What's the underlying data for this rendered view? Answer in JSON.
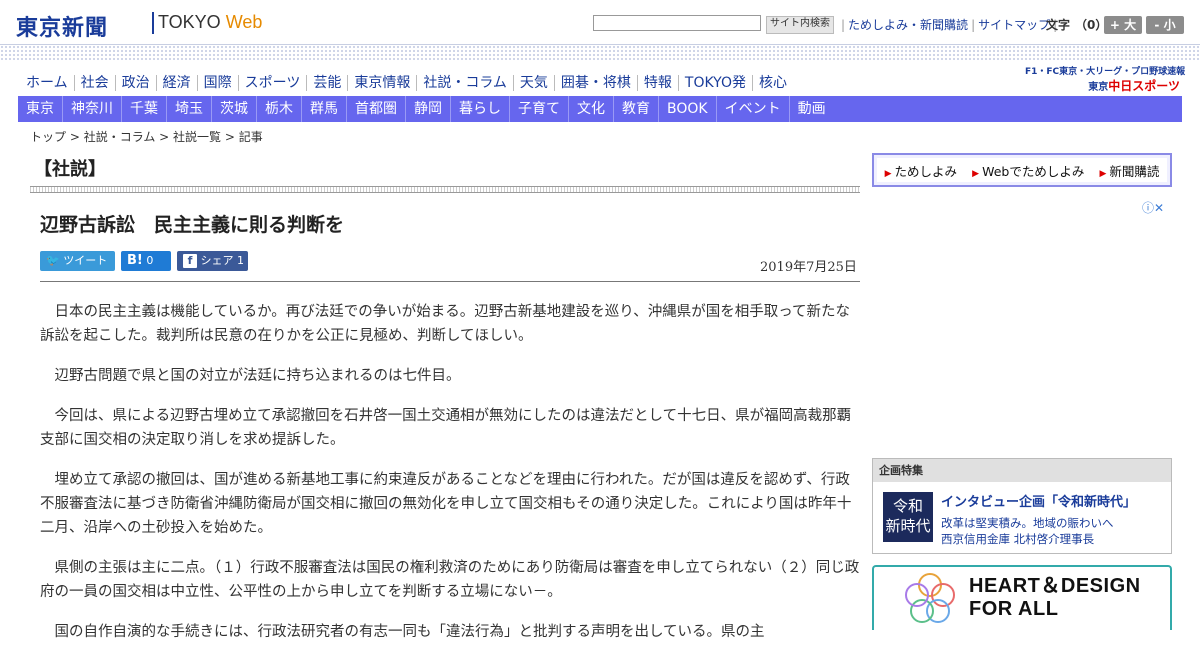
{
  "header": {
    "logo_ja": "東京新聞",
    "logo_en_1": "TOKYO",
    "logo_en_2": "Web",
    "search_placeholder": "",
    "search_button": "サイト内検索",
    "top_links": [
      "ためしよみ・新聞購読",
      "サイトマップ"
    ],
    "font_label": "文字",
    "font_value": "（0）",
    "font_plus": "+ 大",
    "font_minus": "- 小"
  },
  "main_nav": [
    "ホーム",
    "社会",
    "政治",
    "経済",
    "国際",
    "スポーツ",
    "芸能",
    "東京情報",
    "社説・コラム",
    "天気",
    "囲碁・将棋",
    "特報",
    "TOKYO発",
    "核心"
  ],
  "chunichi": {
    "line1": "F1・FC東京・大リーグ・プロ野球速報",
    "prefix": "東京",
    "name": "中日スポーツ"
  },
  "sub_nav": [
    "東京",
    "神奈川",
    "千葉",
    "埼玉",
    "茨城",
    "栃木",
    "群馬",
    "首都圏",
    "静岡",
    "暮らし",
    "子育て",
    "文化",
    "教育",
    "BOOK",
    "イベント",
    "動画"
  ],
  "breadcrumb": [
    "トップ",
    "社説・コラム",
    "社説一覧",
    "記事"
  ],
  "section_title": "【社説】",
  "article": {
    "headline": "辺野古訴訟　民主主義に則る判断を",
    "share": {
      "tweet": "ツイート",
      "hatena_count": "0",
      "facebook": "シェア",
      "facebook_count": "1"
    },
    "date": "2019年7月25日",
    "paragraphs": [
      "日本の民主主義は機能しているか。再び法廷での争いが始まる。辺野古新基地建設を巡り、沖縄県が国を相手取って新たな訴訟を起こした。裁判所は民意の在りかを公正に見極め、判断してほしい。",
      "辺野古問題で県と国の対立が法廷に持ち込まれるのは七件目。",
      "今回は、県による辺野古埋め立て承認撤回を石井啓一国土交通相が無効にしたのは違法だとして十七日、県が福岡高裁那覇支部に国交相の決定取り消しを求め提訴した。",
      "埋め立て承認の撤回は、国が進める新基地工事に約束違反があることなどを理由に行われた。だが国は違反を認めず、行政不服審査法に基づき防衛省沖縄防衛局が国交相に撤回の無効化を申し立て国交相もその通り決定した。これにより国は昨年十二月、沿岸への土砂投入を始めた。",
      "県側の主張は主に二点。（１）行政不服審査法は国民の権利救済のためにあり防衛局は審査を申し立てられない（２）同じ政府の一員の国交相は中立性、公平性の上から申し立てを判断する立場にない－。",
      "国の自作自演的な手続きには、行政法研究者の有志一同も「違法行為」と批判する声明を出している。県の主"
    ]
  },
  "sidebar": {
    "promo": [
      "ためしよみ",
      "Webでためしよみ",
      "新聞購読"
    ],
    "ad_info": "ⓘ✕",
    "feature": {
      "header": "企画特集",
      "thumb_line1": "令和",
      "thumb_line2": "新時代",
      "title": "インタビュー企画「令和新時代」",
      "sub1": "改革は堅実積み。地域の賑わいへ",
      "sub2": "西京信用金庫 北村啓介理事長"
    },
    "heart_line1": "HEART＆DESIGN",
    "heart_line2": "FOR ALL"
  }
}
